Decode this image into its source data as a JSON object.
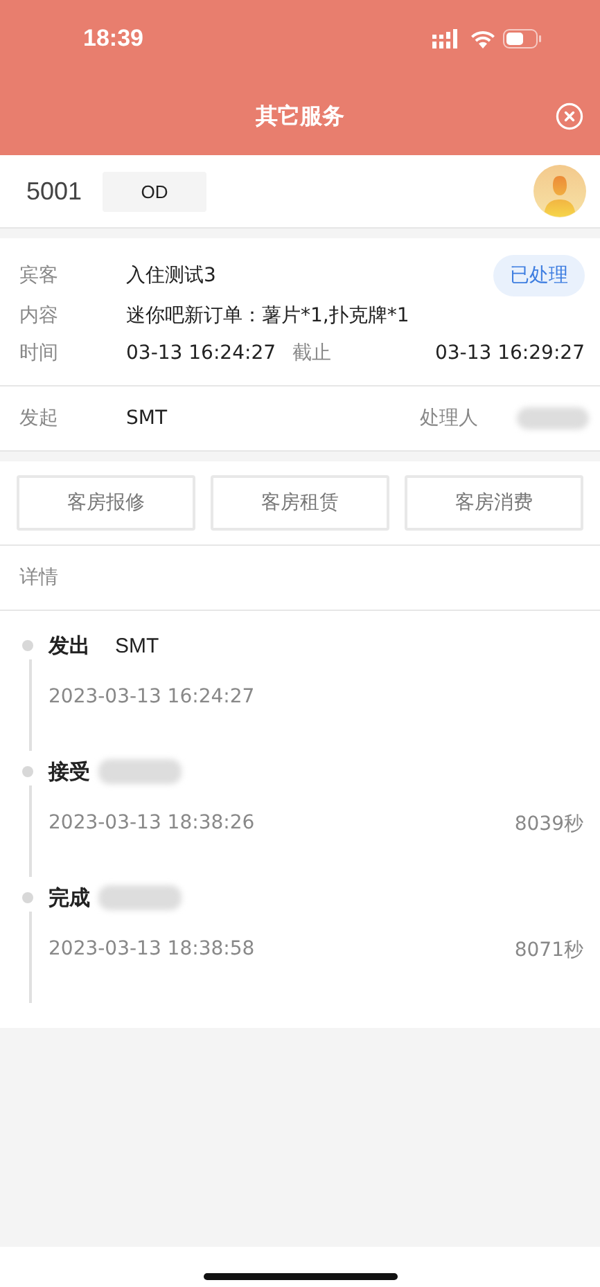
{
  "status_bar": {
    "time": "18:39"
  },
  "header": {
    "title": "其它服务"
  },
  "room": {
    "number": "5001",
    "status": "OD"
  },
  "info": {
    "guest_label": "宾客",
    "guest": "入住测试3",
    "badge": "已处理",
    "content_label": "内容",
    "content": "迷你吧新订单：薯片*1,扑克牌*1",
    "time_label": "时间",
    "start": "03-13 16:24:27",
    "deadline_label": "截止",
    "deadline": "03-13 16:29:27"
  },
  "origin": {
    "label": "发起",
    "value": "SMT",
    "handler_label": "处理人",
    "handler_hidden": true
  },
  "actions": [
    "客房报修",
    "客房租赁",
    "客房消费"
  ],
  "details_label": "详情",
  "timeline": [
    {
      "label": "发出",
      "actor": "SMT",
      "actor_hidden": false,
      "time": "2023-03-13 16:24:27"
    },
    {
      "label": "接受",
      "actor_hidden": true,
      "time": "2023-03-13 18:38:26",
      "duration": "8039秒"
    },
    {
      "label": "完成",
      "actor_hidden": true,
      "time": "2023-03-13 18:38:58",
      "duration": "8071秒"
    }
  ]
}
